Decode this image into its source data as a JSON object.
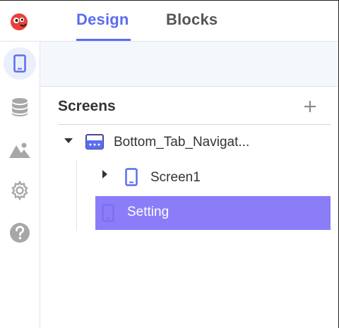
{
  "header": {
    "tabs": [
      {
        "label": "Design",
        "active": true
      },
      {
        "label": "Blocks",
        "active": false
      }
    ]
  },
  "sidebar": {
    "items": [
      {
        "icon": "phone-icon",
        "active": true
      },
      {
        "icon": "database-icon",
        "active": false
      },
      {
        "icon": "image-icon",
        "active": false
      },
      {
        "icon": "gear-icon",
        "active": false
      },
      {
        "icon": "help-icon",
        "active": false
      }
    ]
  },
  "screens": {
    "title": "Screens",
    "add_icon": "plus-icon",
    "tree": [
      {
        "label": "Bottom_Tab_Navigat...",
        "icon": "tab-navigator-icon",
        "expanded": true
      },
      {
        "label": "Screen1",
        "icon": "phone-icon",
        "expanded": false
      },
      {
        "label": "Setting",
        "icon": "phone-icon",
        "selected": true
      }
    ]
  },
  "colors": {
    "accent": "#5b6cf0",
    "selected": "#8b7df8",
    "strip": "#f4f8fd",
    "icon_gray": "#a7a7a7"
  }
}
